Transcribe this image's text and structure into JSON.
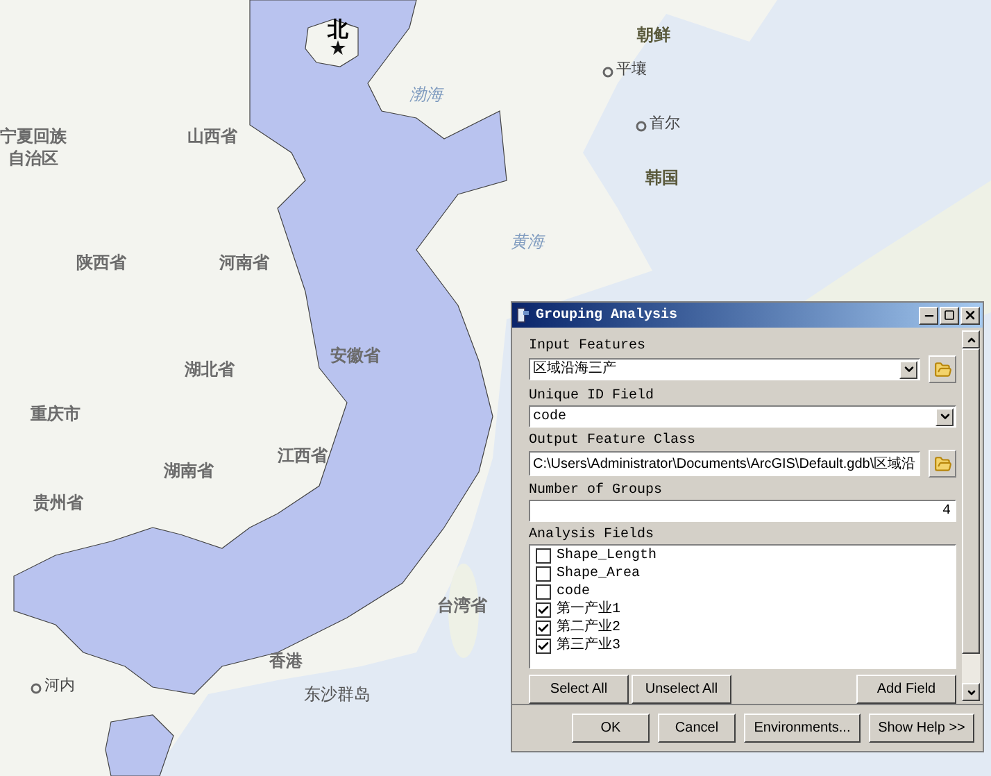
{
  "map": {
    "labels": [
      {
        "text": "北",
        "kind": "capital"
      },
      {
        "text": "山西省",
        "kind": "province"
      },
      {
        "text": "宁夏回族",
        "kind": "province"
      },
      {
        "text": "自治区",
        "kind": "province"
      },
      {
        "text": "陕西省",
        "kind": "province"
      },
      {
        "text": "河南省",
        "kind": "province"
      },
      {
        "text": "湖北省",
        "kind": "province"
      },
      {
        "text": "安徽省",
        "kind": "province"
      },
      {
        "text": "重庆市",
        "kind": "province"
      },
      {
        "text": "湖南省",
        "kind": "province"
      },
      {
        "text": "江西省",
        "kind": "province"
      },
      {
        "text": "贵州省",
        "kind": "province"
      },
      {
        "text": "台湾省",
        "kind": "province"
      },
      {
        "text": "香港",
        "kind": "province"
      },
      {
        "text": "东沙群岛",
        "kind": "place"
      },
      {
        "text": "河内",
        "kind": "city"
      },
      {
        "text": "渤海",
        "kind": "sea"
      },
      {
        "text": "黄海",
        "kind": "sea"
      },
      {
        "text": "朝鲜",
        "kind": "country"
      },
      {
        "text": "平壤",
        "kind": "city"
      },
      {
        "text": "首尔",
        "kind": "city"
      },
      {
        "text": "韩国",
        "kind": "country"
      }
    ]
  },
  "dialog": {
    "title": "Grouping Analysis",
    "input_features": {
      "label": "Input Features",
      "value": "区域沿海三产"
    },
    "unique_id_field": {
      "label": "Unique ID Field",
      "value": "code"
    },
    "output_feature_class": {
      "label": "Output Feature Class",
      "value": "C:\\Users\\Administrator\\Documents\\ArcGIS\\Default.gdb\\区域沿"
    },
    "number_of_groups": {
      "label": "Number of Groups",
      "value": "4"
    },
    "analysis_fields": {
      "label": "Analysis Fields",
      "items": [
        {
          "label": "Shape_Length",
          "checked": false
        },
        {
          "label": "Shape_Area",
          "checked": false
        },
        {
          "label": "code",
          "checked": false
        },
        {
          "label": "第一产业1",
          "checked": true
        },
        {
          "label": "第二产业2",
          "checked": true
        },
        {
          "label": "第三产业3",
          "checked": true
        }
      ],
      "buttons": [
        "Select All",
        "Unselect All",
        "Add Field"
      ]
    },
    "buttons": [
      "OK",
      "Cancel",
      "Environments...",
      "Show Help >>"
    ]
  }
}
